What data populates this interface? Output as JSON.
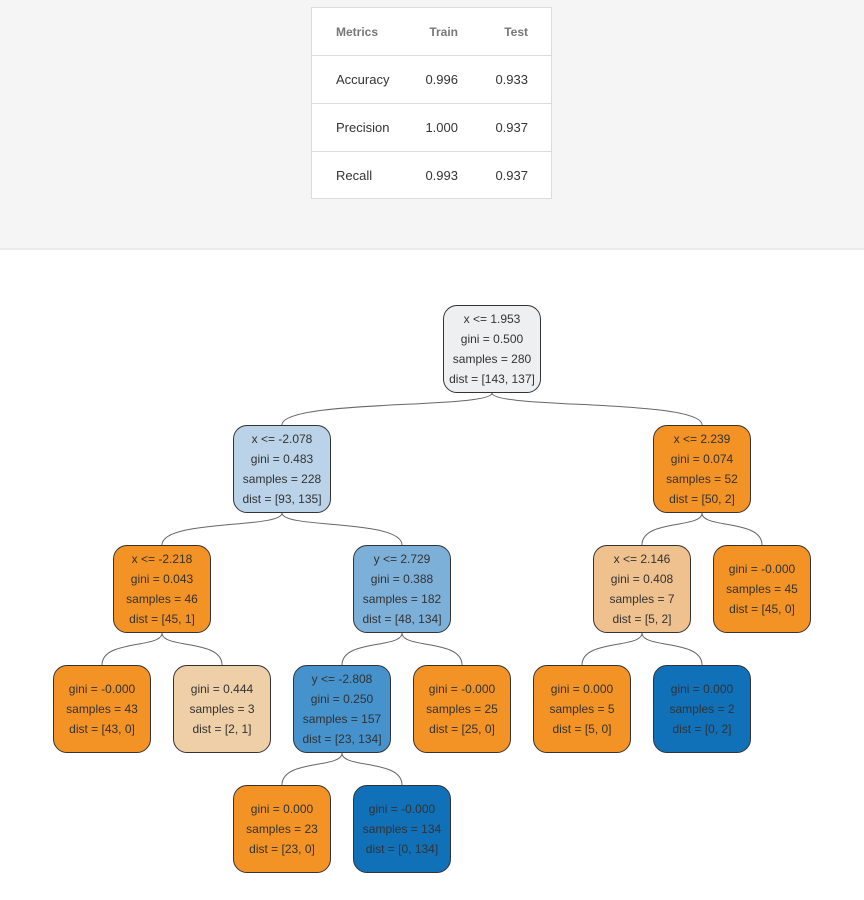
{
  "metrics": {
    "headers": [
      "Metrics",
      "Train",
      "Test"
    ],
    "rows": [
      {
        "metric": "Accuracy",
        "train": "0.996",
        "test": "0.933"
      },
      {
        "metric": "Precision",
        "train": "1.000",
        "test": "0.937"
      },
      {
        "metric": "Recall",
        "train": "0.993",
        "test": "0.937"
      }
    ]
  },
  "colors": {
    "class0": "#f39325",
    "class1": "#1070b8",
    "edge": "#666666",
    "border": "#333333"
  },
  "tree": {
    "nodes": [
      {
        "id": 0,
        "lines": [
          "x <= 1.953",
          "gini = 0.500",
          "samples = 280",
          "dist = [143, 137]"
        ],
        "color": "#eeeff1",
        "children": [
          1,
          2
        ]
      },
      {
        "id": 1,
        "lines": [
          "x <= -2.078",
          "gini = 0.483",
          "samples = 228",
          "dist = [93, 135]"
        ],
        "color": "#bad3e8",
        "children": [
          3,
          4
        ]
      },
      {
        "id": 2,
        "lines": [
          "x <= 2.239",
          "gini = 0.074",
          "samples = 52",
          "dist = [50, 2]"
        ],
        "color": "#f39325",
        "children": [
          5,
          6
        ]
      },
      {
        "id": 3,
        "lines": [
          "x <= -2.218",
          "gini = 0.043",
          "samples = 46",
          "dist = [45, 1]"
        ],
        "color": "#f39325",
        "children": [
          7,
          8
        ]
      },
      {
        "id": 4,
        "lines": [
          "y <= 2.729",
          "gini = 0.388",
          "samples = 182",
          "dist = [48, 134]"
        ],
        "color": "#7db0d8",
        "children": [
          9,
          10
        ]
      },
      {
        "id": 5,
        "lines": [
          "x <= 2.146",
          "gini = 0.408",
          "samples = 7",
          "dist = [5, 2]"
        ],
        "color": "#efc18e",
        "children": [
          11,
          12
        ]
      },
      {
        "id": 6,
        "lines": [
          "gini = -0.000",
          "samples = 45",
          "dist = [45, 0]"
        ],
        "color": "#f39325",
        "children": []
      },
      {
        "id": 7,
        "lines": [
          "gini = -0.000",
          "samples = 43",
          "dist = [43, 0]"
        ],
        "color": "#f39325",
        "children": []
      },
      {
        "id": 8,
        "lines": [
          "gini = 0.444",
          "samples = 3",
          "dist = [2, 1]"
        ],
        "color": "#efcfa7",
        "children": []
      },
      {
        "id": 9,
        "lines": [
          "y <= -2.808",
          "gini = 0.250",
          "samples = 157",
          "dist = [23, 134]"
        ],
        "color": "#4592cc",
        "children": [
          13,
          14
        ]
      },
      {
        "id": 10,
        "lines": [
          "gini = -0.000",
          "samples = 25",
          "dist = [25, 0]"
        ],
        "color": "#f39325",
        "children": []
      },
      {
        "id": 11,
        "lines": [
          "gini = 0.000",
          "samples = 5",
          "dist = [5, 0]"
        ],
        "color": "#f39325",
        "children": []
      },
      {
        "id": 12,
        "lines": [
          "gini = 0.000",
          "samples = 2",
          "dist = [0, 2]"
        ],
        "color": "#1070b8",
        "children": []
      },
      {
        "id": 13,
        "lines": [
          "gini = 0.000",
          "samples = 23",
          "dist = [23, 0]"
        ],
        "color": "#f39325",
        "children": []
      },
      {
        "id": 14,
        "lines": [
          "gini = -0.000",
          "samples = 134",
          "dist = [0, 134]"
        ],
        "color": "#1070b8",
        "children": []
      }
    ]
  }
}
